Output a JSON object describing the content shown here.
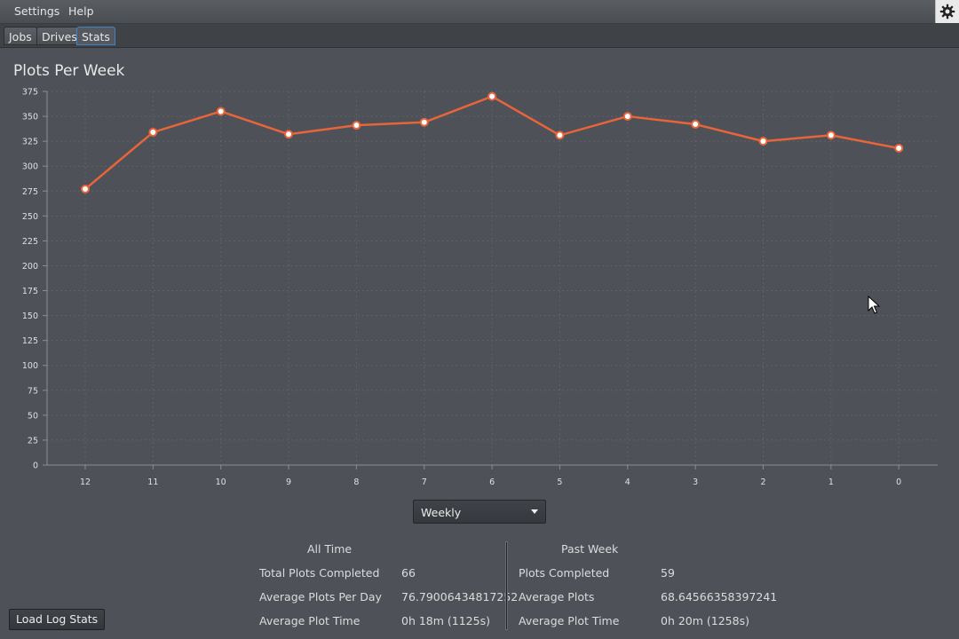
{
  "menubar": {
    "settings": "Settings",
    "help": "Help",
    "gear_icon": "gear-icon"
  },
  "tabs": [
    {
      "label": "Jobs",
      "active": false
    },
    {
      "label": "Drives",
      "active": false
    },
    {
      "label": "Stats",
      "active": true
    }
  ],
  "chart_data": {
    "type": "line",
    "title": "Plots Per Week",
    "categories": [
      "12",
      "11",
      "10",
      "9",
      "8",
      "7",
      "6",
      "5",
      "4",
      "3",
      "2",
      "1",
      "0"
    ],
    "values": [
      277,
      334,
      355,
      332,
      341,
      344,
      370,
      331,
      350,
      342,
      325,
      331,
      318
    ],
    "ylim": [
      0,
      375
    ],
    "yticks": [
      "0",
      "25",
      "50",
      "75",
      "100",
      "125",
      "150",
      "175",
      "200",
      "225",
      "250",
      "275",
      "300",
      "325",
      "350",
      "375"
    ],
    "grid": true,
    "color": "#e8643a"
  },
  "period_select": {
    "value": "Weekly"
  },
  "stats": {
    "all_time": {
      "heading": "All Time",
      "rows": [
        {
          "label": "Total Plots Completed",
          "value": "66"
        },
        {
          "label": "Average Plots Per Day",
          "value": "76.79006434817252"
        },
        {
          "label": "Average Plot Time",
          "value": "0h 18m (1125s)"
        }
      ]
    },
    "past_week": {
      "heading": "Past Week",
      "rows": [
        {
          "label": "Plots Completed",
          "value": "59"
        },
        {
          "label": "Average Plots",
          "value": "68.64566358397241"
        },
        {
          "label": "Average Plot Time",
          "value": "0h 20m (1258s)"
        }
      ]
    }
  },
  "load_button": {
    "label": "Load Log Stats"
  }
}
